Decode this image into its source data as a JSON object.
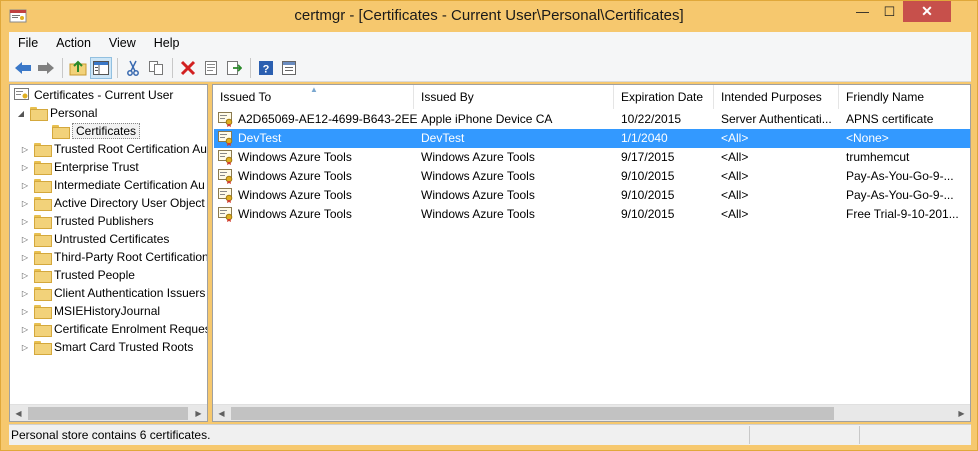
{
  "window": {
    "title": "certmgr - [Certificates - Current User\\Personal\\Certificates]",
    "controls": {
      "minimize": "—",
      "maximize": "☐",
      "close": "✕"
    }
  },
  "menu": {
    "items": [
      "File",
      "Action",
      "View",
      "Help"
    ]
  },
  "toolbar": {
    "buttons": [
      "back-arrow-icon",
      "forward-arrow-icon",
      "up-folder-icon",
      "show-hide-console-tree-icon",
      "cut-icon",
      "copy-icon",
      "delete-icon",
      "properties-icon",
      "export-list-icon",
      "help-icon",
      "help-topics-icon"
    ]
  },
  "tree": {
    "root": "Certificates - Current User",
    "personal": "Personal",
    "certificates": "Certificates",
    "stores": [
      "Trusted Root Certification Au",
      "Enterprise Trust",
      "Intermediate Certification Au",
      "Active Directory User Object",
      "Trusted Publishers",
      "Untrusted Certificates",
      "Third-Party Root Certification",
      "Trusted People",
      "Client Authentication Issuers",
      "MSIEHistoryJournal",
      "Certificate Enrolment Reques",
      "Smart Card Trusted Roots"
    ]
  },
  "table": {
    "columns": [
      "Issued To",
      "Issued By",
      "Expiration Date",
      "Intended Purposes",
      "Friendly Name"
    ],
    "rows": [
      [
        "A2D65069-AE12-4699-B643-2EE...",
        "Apple iPhone Device CA",
        "10/22/2015",
        "Server Authenticati...",
        "APNS certificate"
      ],
      [
        "DevTest",
        "DevTest",
        "1/1/2040",
        "<All>",
        "<None>"
      ],
      [
        "Windows Azure Tools",
        "Windows Azure Tools",
        "9/17/2015",
        "<All>",
        "trumhemcut"
      ],
      [
        "Windows Azure Tools",
        "Windows Azure Tools",
        "9/10/2015",
        "<All>",
        "Pay-As-You-Go-9-..."
      ],
      [
        "Windows Azure Tools",
        "Windows Azure Tools",
        "9/10/2015",
        "<All>",
        "Pay-As-You-Go-9-..."
      ],
      [
        "Windows Azure Tools",
        "Windows Azure Tools",
        "9/10/2015",
        "<All>",
        "Free Trial-9-10-201..."
      ]
    ],
    "selected_row": 1
  },
  "status": {
    "text": "Personal store contains 6 certificates."
  },
  "colors": {
    "title_bar": "#f6c86e",
    "selection": "#3399ff",
    "close_button": "#c7504b"
  }
}
